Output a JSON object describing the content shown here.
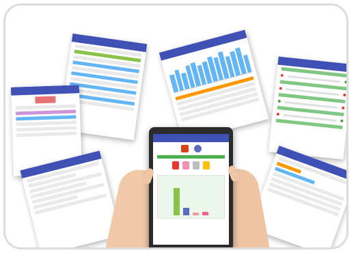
{
  "scene": {
    "description_colors": {
      "appbar": "#3f51b5",
      "green": "#4caf50",
      "orange": "#ff9800",
      "blue": "#64b5f6"
    }
  },
  "tablet": {
    "chart_bars": [
      {
        "value": 80,
        "color": "#8bc34a"
      },
      {
        "value": 22,
        "color": "#5c6bc0"
      },
      {
        "value": 8,
        "color": "#ef9a9a"
      },
      {
        "value": 10,
        "color": "#f06292"
      }
    ]
  }
}
